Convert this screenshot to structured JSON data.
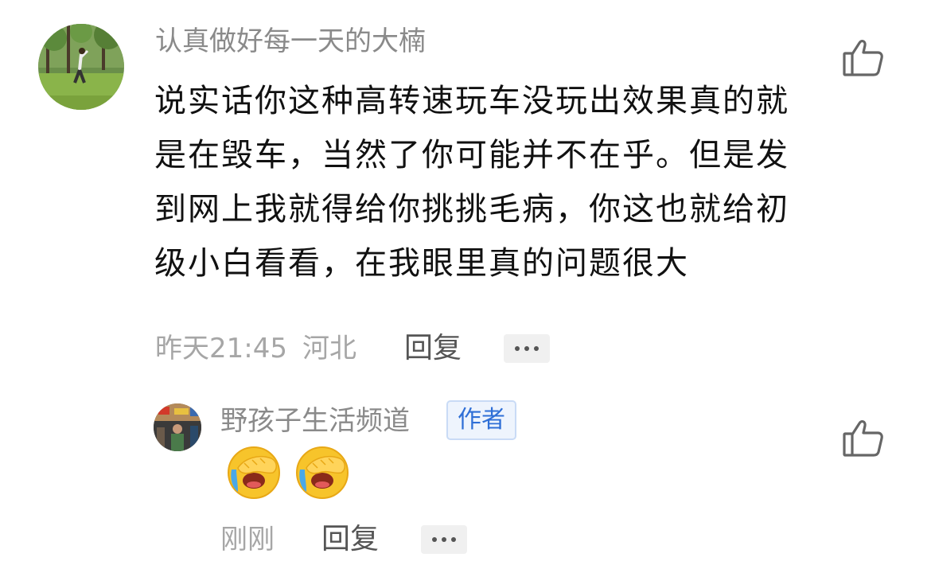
{
  "main_comment": {
    "username": "认真做好每一天的大楠",
    "avatar": "avatar-photo",
    "text": "说实话你这种高转速玩车没玩出效果真的就是在毁车，当然了你可能并不在乎。但是发到网上我就得给你挑挑毛病，你这也就给初级小白看看，在我眼里真的问题很大",
    "time": "昨天21:45",
    "location": "河北",
    "reply_label": "回复",
    "more_icon": "more-icon",
    "like_icon": "thumbs-up-icon"
  },
  "reply": {
    "username": "野孩子生活频道",
    "badge": "作者",
    "avatar": "avatar-photo",
    "emojis": [
      "facepalm-cry-emoji",
      "facepalm-cry-emoji"
    ],
    "time": "刚刚",
    "reply_label": "回复",
    "more_icon": "more-icon",
    "like_icon": "thumbs-up-icon"
  },
  "colors": {
    "username": "#8a8a8a",
    "comment_text": "#111111",
    "meta": "#a6a6a6",
    "action": "#555555",
    "badge_text": "#2f6fd6",
    "badge_bg": "#eef4fd",
    "badge_border": "#c9dbf6"
  }
}
